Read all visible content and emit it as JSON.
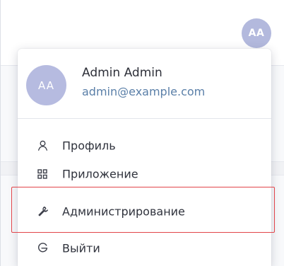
{
  "topbar": {
    "avatar_initials": "AA"
  },
  "user_menu": {
    "avatar_initials": "AA",
    "name": "Admin Admin",
    "email": "admin@example.com",
    "items": [
      {
        "label": "Профиль",
        "icon": "user-icon"
      },
      {
        "label": "Приложение",
        "icon": "grid-icon"
      },
      {
        "label": "Администрирование",
        "icon": "wrench-icon"
      },
      {
        "label": "Выйти",
        "icon": "logout-icon"
      }
    ],
    "highlighted_item": "Администрирование"
  },
  "colors": {
    "avatar_bg": "#b6bbe0",
    "email_text": "#5a7fa8",
    "highlight_border": "#e2454a"
  }
}
